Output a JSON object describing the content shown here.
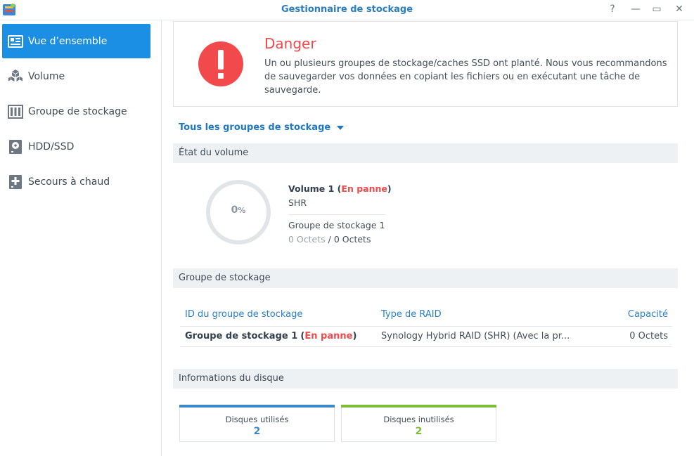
{
  "window": {
    "title": "Gestionnaire de stockage",
    "controls": {
      "help": "?",
      "minimize": "—",
      "maximize": "▭",
      "close": "✕"
    }
  },
  "sidebar": {
    "items": [
      {
        "label": "Vue d’ensemble",
        "icon": "overview-icon",
        "active": true
      },
      {
        "label": "Volume",
        "icon": "cubes-icon",
        "active": false
      },
      {
        "label": "Groupe de stockage",
        "icon": "storage-pool-icon",
        "active": false
      },
      {
        "label": "HDD/SSD",
        "icon": "disk-icon",
        "active": false
      },
      {
        "label": "Secours à chaud",
        "icon": "hot-spare-icon",
        "active": false
      }
    ]
  },
  "alert": {
    "title": "Danger",
    "message": "Un ou plusieurs groupes de stockage/caches SSD ont planté. Nous vous recommandons de sauvegarder vos données en copiant les fichiers ou en exécutant une tâche de sauvegarde.",
    "color": "#f1494c"
  },
  "filter": {
    "label": "Tous les groupes de stockage"
  },
  "volume_section": {
    "header": "État du volume",
    "usage_value": "0",
    "usage_unit": "%",
    "usage_fraction": 0,
    "name": "Volume 1",
    "status": "En panne",
    "type": "SHR",
    "pool": "Groupe de stockage 1",
    "used": "0 Octets",
    "total": "0 Octets"
  },
  "pool_section": {
    "header": "Groupe de stockage",
    "columns": [
      "ID du groupe de stockage",
      "Type de RAID",
      "Capacité"
    ],
    "rows": [
      {
        "id": "Groupe de stockage 1",
        "status": "En panne",
        "raid": "Synology Hybrid RAID (SHR) (Avec la pr...",
        "capacity": "0 Octets"
      }
    ]
  },
  "disk_section": {
    "header": "Informations du disque",
    "cards": [
      {
        "label": "Disques utilisés",
        "value": "2",
        "color": "#3d88c9"
      },
      {
        "label": "Disques inutilisés",
        "value": "2",
        "color": "#7bbd36"
      }
    ]
  }
}
